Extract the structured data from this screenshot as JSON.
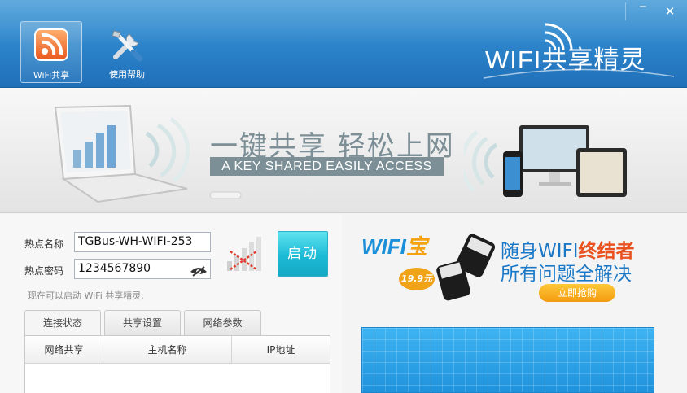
{
  "header": {
    "toolbar": [
      {
        "label": "WiFi共享",
        "icon": "rss-share-icon",
        "active": true
      },
      {
        "label": "使用帮助",
        "icon": "tools-icon",
        "active": false
      }
    ],
    "brand": "WIFI共享精灵",
    "window_controls": {
      "minimize": "‾",
      "close": "✕"
    }
  },
  "banner": {
    "title": "一键共享 轻松上网",
    "subtitle": "A KEY SHARED EASILY ACCESS"
  },
  "form": {
    "ssid_label": "热点名称",
    "ssid_value": "TGBus-WH-WIFI-253",
    "password_label": "热点密码",
    "password_value": "1234567890",
    "start_label": "启动",
    "status": "现在可以启动 WiFi 共享精灵."
  },
  "tabs": [
    {
      "label": "连接状态",
      "active": true
    },
    {
      "label": "共享设置",
      "active": false
    },
    {
      "label": "网络参数",
      "active": false
    }
  ],
  "table": {
    "columns": [
      "网络共享",
      "主机名称",
      "IP地址"
    ],
    "rows": []
  },
  "ad": {
    "logo_main": "WIFI",
    "logo_accent": "宝",
    "price": "19.9元",
    "line1_prefix": "随身WIFI",
    "line1_emphasis": "终结者",
    "line2": "所有问题全解决",
    "buy": "立即抢购"
  },
  "colors": {
    "header_blue": "#2f87cc",
    "start_button": "#1cbad6",
    "ad_blue": "#1b78c7",
    "ad_orange": "#e9521f"
  }
}
